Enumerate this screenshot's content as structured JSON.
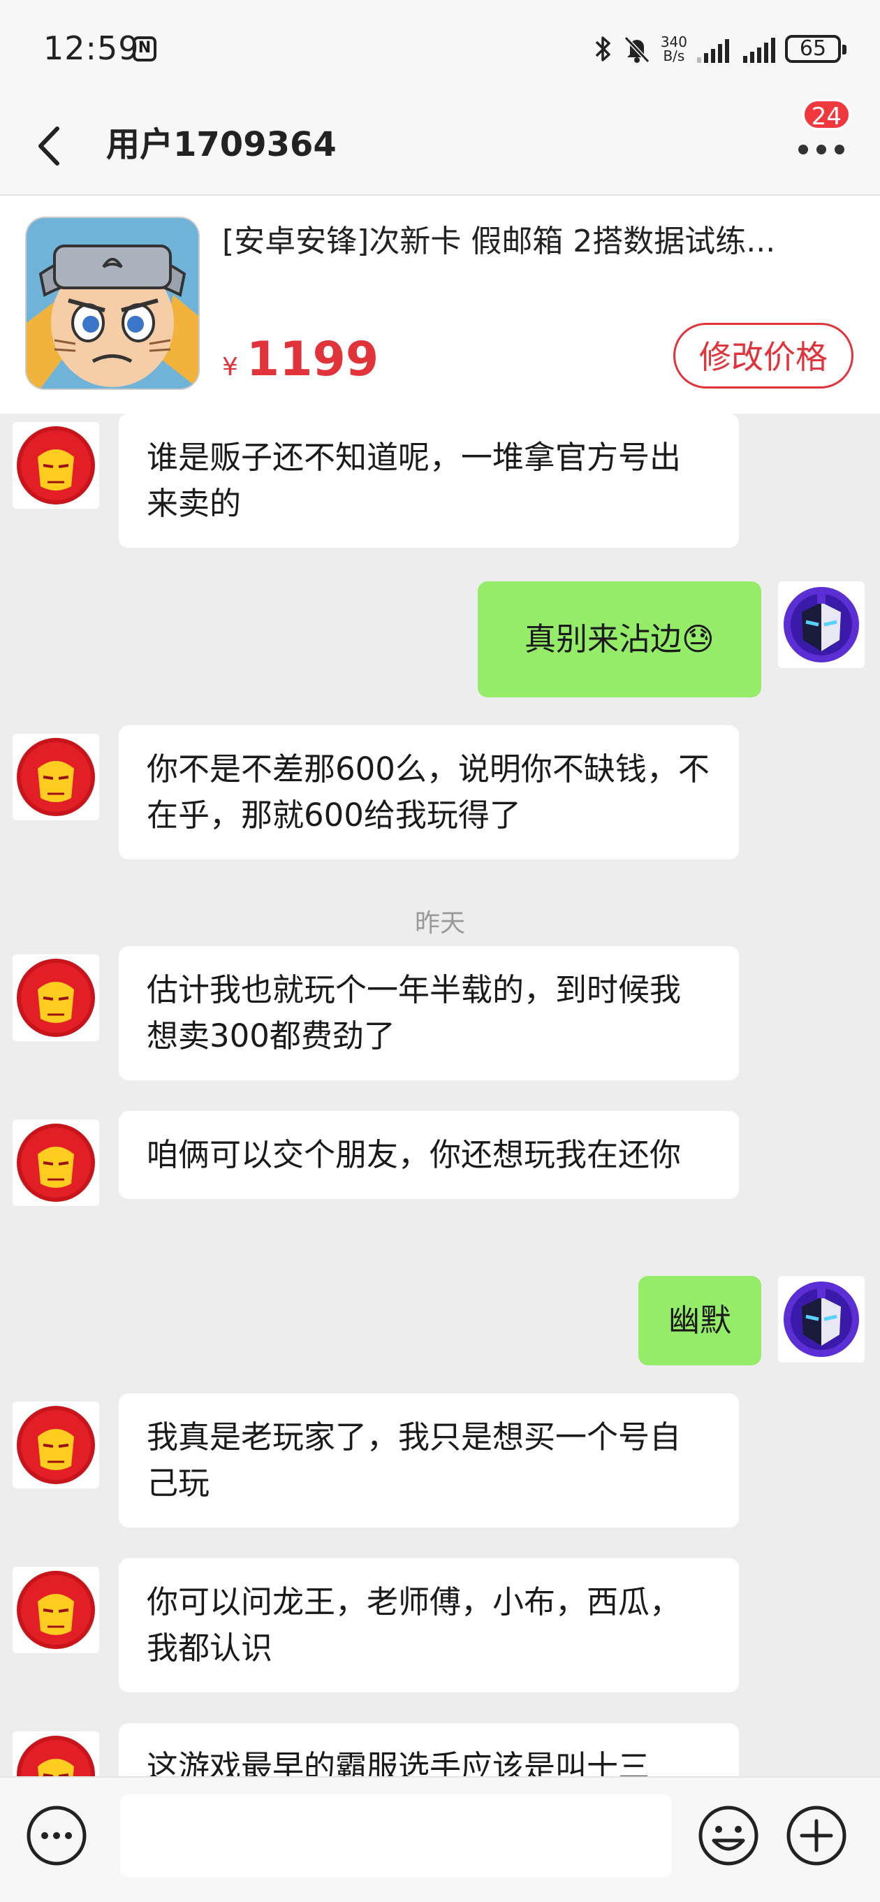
{
  "status_bar": {
    "time": "12:59",
    "nfc": "N",
    "net_speed_value": "340",
    "net_speed_unit": "B/s",
    "battery": "65"
  },
  "header": {
    "title": "用户1709364",
    "badge_count": "24"
  },
  "product": {
    "title": "[安卓安锋]次新卡 假邮箱 2搭数据试练...",
    "currency": "¥",
    "price": "1199",
    "edit_price_label": "修改价格"
  },
  "chat": {
    "timestamp": "昨天",
    "messages": [
      {
        "side": "in",
        "text": "谁是贩子还不知道呢，一堆拿官方号出来卖的"
      },
      {
        "side": "out",
        "text": "真别来沾边😓"
      },
      {
        "side": "in",
        "text": "你不是不差那600么，说明你不缺钱，不在乎，那就600给我玩得了"
      },
      {
        "side": "in",
        "text": "估计我也就玩个一年半载的，到时候我想卖300都费劲了"
      },
      {
        "side": "in",
        "text": "咱俩可以交个朋友，你还想玩我在还你"
      },
      {
        "side": "out",
        "text": "幽默"
      },
      {
        "side": "in",
        "text": "我真是老玩家了，我只是想买一个号自己玩"
      },
      {
        "side": "in",
        "text": "你可以问龙王，老师傅，小布，西瓜，我都认识"
      },
      {
        "side": "in",
        "text": "这游戏最早的霸服选手应该是叫十三"
      }
    ]
  },
  "input_bar": {
    "placeholder": ""
  },
  "colors": {
    "accent_red": "#e0343a",
    "sent_bubble": "#95ec69",
    "background": "#ededed"
  }
}
